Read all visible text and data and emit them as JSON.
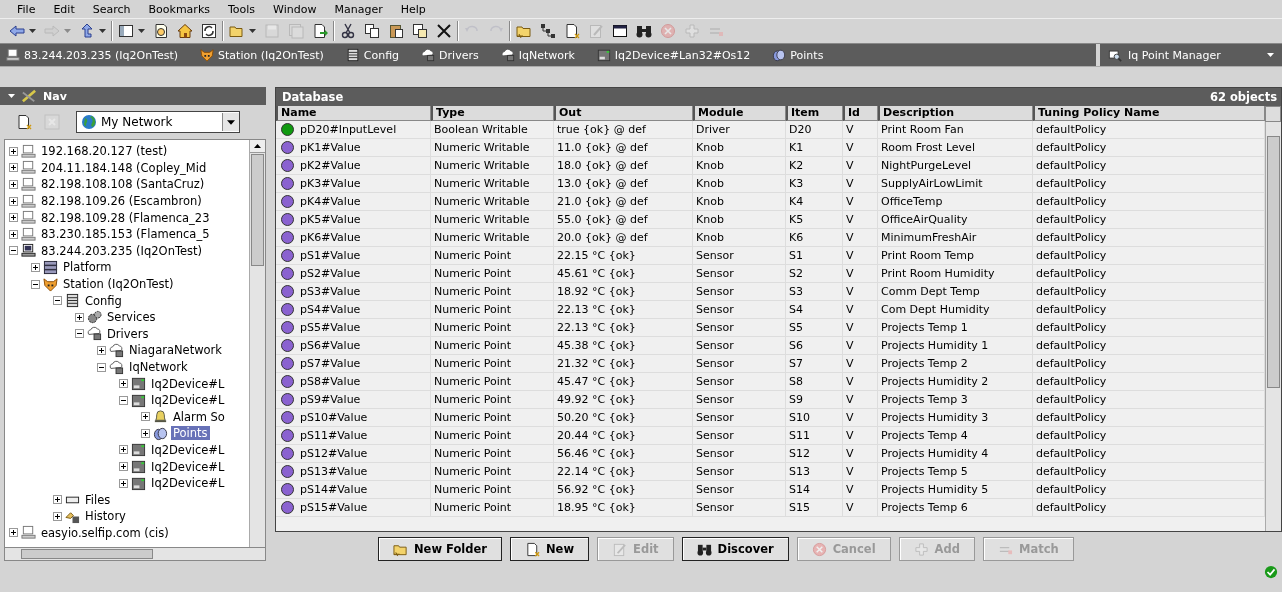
{
  "menu": [
    "File",
    "Edit",
    "Search",
    "Bookmarks",
    "Tools",
    "Window",
    "Manager",
    "Help"
  ],
  "toolbar": [
    [
      {
        "kind": "back",
        "disabled": false,
        "dropdown": true
      },
      {
        "kind": "forward",
        "disabled": true,
        "dropdown": true
      },
      {
        "kind": "up",
        "disabled": false,
        "dropdown": true
      }
    ],
    [
      {
        "kind": "sidebar",
        "disabled": false,
        "dropdown": true
      },
      {
        "kind": "clockdoc",
        "disabled": false
      },
      {
        "kind": "home",
        "disabled": false
      },
      {
        "kind": "refresh",
        "disabled": false
      }
    ],
    [
      {
        "kind": "folder",
        "disabled": false,
        "dropdown": true
      },
      {
        "kind": "save",
        "disabled": true
      },
      {
        "kind": "saveall",
        "disabled": true
      },
      {
        "kind": "export",
        "disabled": false
      }
    ],
    [
      {
        "kind": "cut",
        "disabled": false
      },
      {
        "kind": "copy",
        "disabled": false
      },
      {
        "kind": "paste",
        "disabled": false
      },
      {
        "kind": "duplicate",
        "disabled": false
      },
      {
        "kind": "delete",
        "disabled": false
      }
    ],
    [
      {
        "kind": "undo",
        "disabled": true
      },
      {
        "kind": "redo",
        "disabled": true
      }
    ],
    [
      {
        "kind": "newfolder",
        "disabled": false
      },
      {
        "kind": "tree",
        "disabled": false
      },
      {
        "kind": "newdoc",
        "disabled": false
      },
      {
        "kind": "edit",
        "disabled": true
      },
      {
        "kind": "window",
        "disabled": false
      },
      {
        "kind": "binoculars",
        "disabled": false
      },
      {
        "kind": "cancel",
        "disabled": true
      },
      {
        "kind": "add",
        "disabled": true
      },
      {
        "kind": "match",
        "disabled": true
      }
    ]
  ],
  "breadcrumbs": [
    {
      "label": "83.244.203.235 (Iq2OnTest)",
      "kind": "host"
    },
    {
      "label": "Station (Iq2OnTest)",
      "kind": "station"
    },
    {
      "label": "Config",
      "kind": "config"
    },
    {
      "label": "Drivers",
      "kind": "network"
    },
    {
      "label": "IqNetwork",
      "kind": "network"
    },
    {
      "label": "Iq2Device#Lan32#Os12",
      "kind": "device"
    },
    {
      "label": "Points",
      "kind": "points"
    }
  ],
  "view_selector": {
    "label": "Iq Point Manager"
  },
  "nav": {
    "title": "Nav",
    "network": "My Network",
    "tree": [
      {
        "label": "192.168.20.127 (test)",
        "kind": "host",
        "expanded": false,
        "selected": false
      },
      {
        "label": "204.11.184.148 (Copley_Mid",
        "kind": "host",
        "expanded": false,
        "selected": false
      },
      {
        "label": "82.198.108.108 (SantaCruz)",
        "kind": "host",
        "expanded": false,
        "selected": false
      },
      {
        "label": "82.198.109.26 (Escambron)",
        "kind": "host",
        "expanded": false,
        "selected": false
      },
      {
        "label": "82.198.109.28 (Flamenca_23",
        "kind": "host",
        "expanded": false,
        "selected": false
      },
      {
        "label": "83.230.185.153 (Flamenca_5",
        "kind": "host",
        "expanded": false,
        "selected": false
      },
      {
        "label": "83.244.203.235 (Iq2OnTest)",
        "kind": "hostactive",
        "expanded": true,
        "selected": false,
        "children": [
          {
            "label": "Platform",
            "kind": "platform",
            "expanded": false,
            "selected": false
          },
          {
            "label": "Station (Iq2OnTest)",
            "kind": "station",
            "expanded": true,
            "selected": false,
            "children": [
              {
                "label": "Config",
                "kind": "config",
                "expanded": true,
                "selected": false,
                "children": [
                  {
                    "label": "Services",
                    "kind": "services",
                    "expanded": false,
                    "selected": false
                  },
                  {
                    "label": "Drivers",
                    "kind": "network",
                    "expanded": true,
                    "selected": false,
                    "children": [
                      {
                        "label": "NiagaraNetwork",
                        "kind": "network",
                        "expanded": false,
                        "selected": false
                      },
                      {
                        "label": "IqNetwork",
                        "kind": "network",
                        "expanded": true,
                        "selected": false,
                        "children": [
                          {
                            "label": "Iq2Device#L",
                            "kind": "device",
                            "expanded": false,
                            "selected": false
                          },
                          {
                            "label": "Iq2Device#L",
                            "kind": "device",
                            "expanded": true,
                            "selected": false,
                            "children": [
                              {
                                "label": "Alarm So",
                                "kind": "alarm",
                                "expanded": false,
                                "selected": false
                              },
                              {
                                "label": "Points",
                                "kind": "points",
                                "expanded": false,
                                "selected": true
                              }
                            ]
                          },
                          {
                            "label": "Iq2Device#L",
                            "kind": "device",
                            "expanded": false,
                            "selected": false
                          },
                          {
                            "label": "Iq2Device#L",
                            "kind": "device",
                            "expanded": false,
                            "selected": false
                          },
                          {
                            "label": "Iq2Device#L",
                            "kind": "device",
                            "expanded": false,
                            "selected": false
                          }
                        ]
                      }
                    ]
                  }
                ]
              },
              {
                "label": "Files",
                "kind": "files",
                "expanded": false,
                "selected": false
              },
              {
                "label": "History",
                "kind": "history",
                "expanded": false,
                "selected": false
              }
            ]
          }
        ]
      },
      {
        "label": "easyio.selfip.com (cis)",
        "kind": "host",
        "expanded": false,
        "selected": false
      }
    ]
  },
  "database": {
    "title": "Database",
    "count": "62 objects",
    "columns": [
      "Name",
      "Type",
      "Out",
      "Module",
      "Item",
      "Id",
      "Description",
      "Tuning Policy Name"
    ],
    "rows": [
      {
        "color": "#109a10",
        "cells": [
          "pD20#InputLevel",
          "Boolean Writable",
          "true {ok} @ def",
          "Driver",
          "D20",
          "V",
          "Print Room Fan",
          "defaultPolicy"
        ]
      },
      {
        "color": "#8a62d0",
        "cells": [
          "pK1#Value",
          "Numeric Writable",
          "11.0 {ok} @ def",
          "Knob",
          "K1",
          "V",
          "Room Frost Level",
          "defaultPolicy"
        ]
      },
      {
        "color": "#8a62d0",
        "cells": [
          "pK2#Value",
          "Numeric Writable",
          "18.0 {ok} @ def",
          "Knob",
          "K2",
          "V",
          "NightPurgeLevel",
          "defaultPolicy"
        ]
      },
      {
        "color": "#8a62d0",
        "cells": [
          "pK3#Value",
          "Numeric Writable",
          "13.0 {ok} @ def",
          "Knob",
          "K3",
          "V",
          "SupplyAirLowLimit",
          "defaultPolicy"
        ]
      },
      {
        "color": "#8a62d0",
        "cells": [
          "pK4#Value",
          "Numeric Writable",
          "21.0 {ok} @ def",
          "Knob",
          "K4",
          "V",
          "OfficeTemp",
          "defaultPolicy"
        ]
      },
      {
        "color": "#8a62d0",
        "cells": [
          "pK5#Value",
          "Numeric Writable",
          "55.0 {ok} @ def",
          "Knob",
          "K5",
          "V",
          "OfficeAirQuality",
          "defaultPolicy"
        ]
      },
      {
        "color": "#8a62d0",
        "cells": [
          "pK6#Value",
          "Numeric Writable",
          "20.0 {ok} @ def",
          "Knob",
          "K6",
          "V",
          "MinimumFreshAir",
          "defaultPolicy"
        ]
      },
      {
        "color": "#8a62d0",
        "cells": [
          "pS1#Value",
          "Numeric Point",
          "22.15 °C {ok}",
          "Sensor",
          "S1",
          "V",
          "Print Room Temp",
          "defaultPolicy"
        ]
      },
      {
        "color": "#8a62d0",
        "cells": [
          "pS2#Value",
          "Numeric Point",
          "45.61 °C {ok}",
          "Sensor",
          "S2",
          "V",
          "Print Room Humidity",
          "defaultPolicy"
        ]
      },
      {
        "color": "#8a62d0",
        "cells": [
          "pS3#Value",
          "Numeric Point",
          "18.92 °C {ok}",
          "Sensor",
          "S3",
          "V",
          "Comm Dept Temp",
          "defaultPolicy"
        ]
      },
      {
        "color": "#8a62d0",
        "cells": [
          "pS4#Value",
          "Numeric Point",
          "22.13 °C {ok}",
          "Sensor",
          "S4",
          "V",
          "Com Dept Humidity",
          "defaultPolicy"
        ]
      },
      {
        "color": "#8a62d0",
        "cells": [
          "pS5#Value",
          "Numeric Point",
          "22.13 °C {ok}",
          "Sensor",
          "S5",
          "V",
          "Projects Temp 1",
          "defaultPolicy"
        ]
      },
      {
        "color": "#8a62d0",
        "cells": [
          "pS6#Value",
          "Numeric Point",
          "45.38 °C {ok}",
          "Sensor",
          "S6",
          "V",
          "Projects Humidity 1",
          "defaultPolicy"
        ]
      },
      {
        "color": "#8a62d0",
        "cells": [
          "pS7#Value",
          "Numeric Point",
          "21.32 °C {ok}",
          "Sensor",
          "S7",
          "V",
          "Projects Temp 2",
          "defaultPolicy"
        ]
      },
      {
        "color": "#8a62d0",
        "cells": [
          "pS8#Value",
          "Numeric Point",
          "45.47 °C {ok}",
          "Sensor",
          "S8",
          "V",
          "Projects Humidity 2",
          "defaultPolicy"
        ]
      },
      {
        "color": "#8a62d0",
        "cells": [
          "pS9#Value",
          "Numeric Point",
          "49.92 °C {ok}",
          "Sensor",
          "S9",
          "V",
          "Projects Temp 3",
          "defaultPolicy"
        ]
      },
      {
        "color": "#8a62d0",
        "cells": [
          "pS10#Value",
          "Numeric Point",
          "50.20 °C {ok}",
          "Sensor",
          "S10",
          "V",
          "Projects Humidity 3",
          "defaultPolicy"
        ]
      },
      {
        "color": "#8a62d0",
        "cells": [
          "pS11#Value",
          "Numeric Point",
          "20.44 °C {ok}",
          "Sensor",
          "S11",
          "V",
          "Projects Temp 4",
          "defaultPolicy"
        ]
      },
      {
        "color": "#8a62d0",
        "cells": [
          "pS12#Value",
          "Numeric Point",
          "56.46 °C {ok}",
          "Sensor",
          "S12",
          "V",
          "Projects Humidity 4",
          "defaultPolicy"
        ]
      },
      {
        "color": "#8a62d0",
        "cells": [
          "pS13#Value",
          "Numeric Point",
          "22.14 °C {ok}",
          "Sensor",
          "S13",
          "V",
          "Projects Temp 5",
          "defaultPolicy"
        ]
      },
      {
        "color": "#8a62d0",
        "cells": [
          "pS14#Value",
          "Numeric Point",
          "56.92 °C {ok}",
          "Sensor",
          "S14",
          "V",
          "Projects Humidity 5",
          "defaultPolicy"
        ]
      },
      {
        "color": "#8a62d0",
        "cells": [
          "pS15#Value",
          "Numeric Point",
          "18.95 °C {ok}",
          "Sensor",
          "S15",
          "V",
          "Projects Temp 6",
          "defaultPolicy"
        ]
      }
    ]
  },
  "buttons": [
    {
      "label": "New Folder",
      "kind": "newfolder",
      "disabled": false
    },
    {
      "label": "New",
      "kind": "newdoc",
      "disabled": false
    },
    {
      "label": "Edit",
      "kind": "edit",
      "disabled": true
    },
    {
      "label": "Discover",
      "kind": "binoculars",
      "disabled": false
    },
    {
      "label": "Cancel",
      "kind": "cancel",
      "disabled": true
    },
    {
      "label": "Add",
      "kind": "add",
      "disabled": true
    },
    {
      "label": "Match",
      "kind": "match",
      "disabled": true
    }
  ]
}
